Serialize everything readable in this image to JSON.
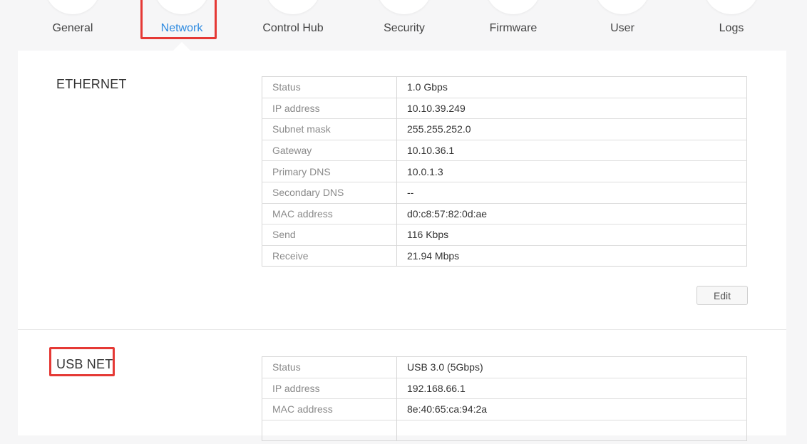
{
  "nav": {
    "active": "Network",
    "items": [
      {
        "label": "General"
      },
      {
        "label": "Network"
      },
      {
        "label": "Control Hub"
      },
      {
        "label": "Security"
      },
      {
        "label": "Firmware"
      },
      {
        "label": "User"
      },
      {
        "label": "Logs"
      }
    ],
    "active_color": "#2d8ae0"
  },
  "ethernet": {
    "title": "ETHERNET",
    "rows": [
      {
        "key": "Status",
        "value": "1.0 Gbps"
      },
      {
        "key": "IP address",
        "value": "10.10.39.249"
      },
      {
        "key": "Subnet mask",
        "value": "255.255.252.0"
      },
      {
        "key": "Gateway",
        "value": "10.10.36.1"
      },
      {
        "key": "Primary DNS",
        "value": "10.0.1.3"
      },
      {
        "key": "Secondary DNS",
        "value": "--"
      },
      {
        "key": "MAC address",
        "value": "d0:c8:57:82:0d:ae"
      },
      {
        "key": "Send",
        "value": "116 Kbps"
      },
      {
        "key": "Receive",
        "value": "21.94 Mbps"
      }
    ],
    "edit_label": "Edit"
  },
  "usb_net": {
    "title": "USB NET",
    "rows": [
      {
        "key": "Status",
        "value": "USB 3.0 (5Gbps)"
      },
      {
        "key": "IP address",
        "value": "192.168.66.1"
      },
      {
        "key": "MAC address",
        "value": "8e:40:65:ca:94:2a"
      }
    ]
  },
  "highlight_color": "#e53935"
}
